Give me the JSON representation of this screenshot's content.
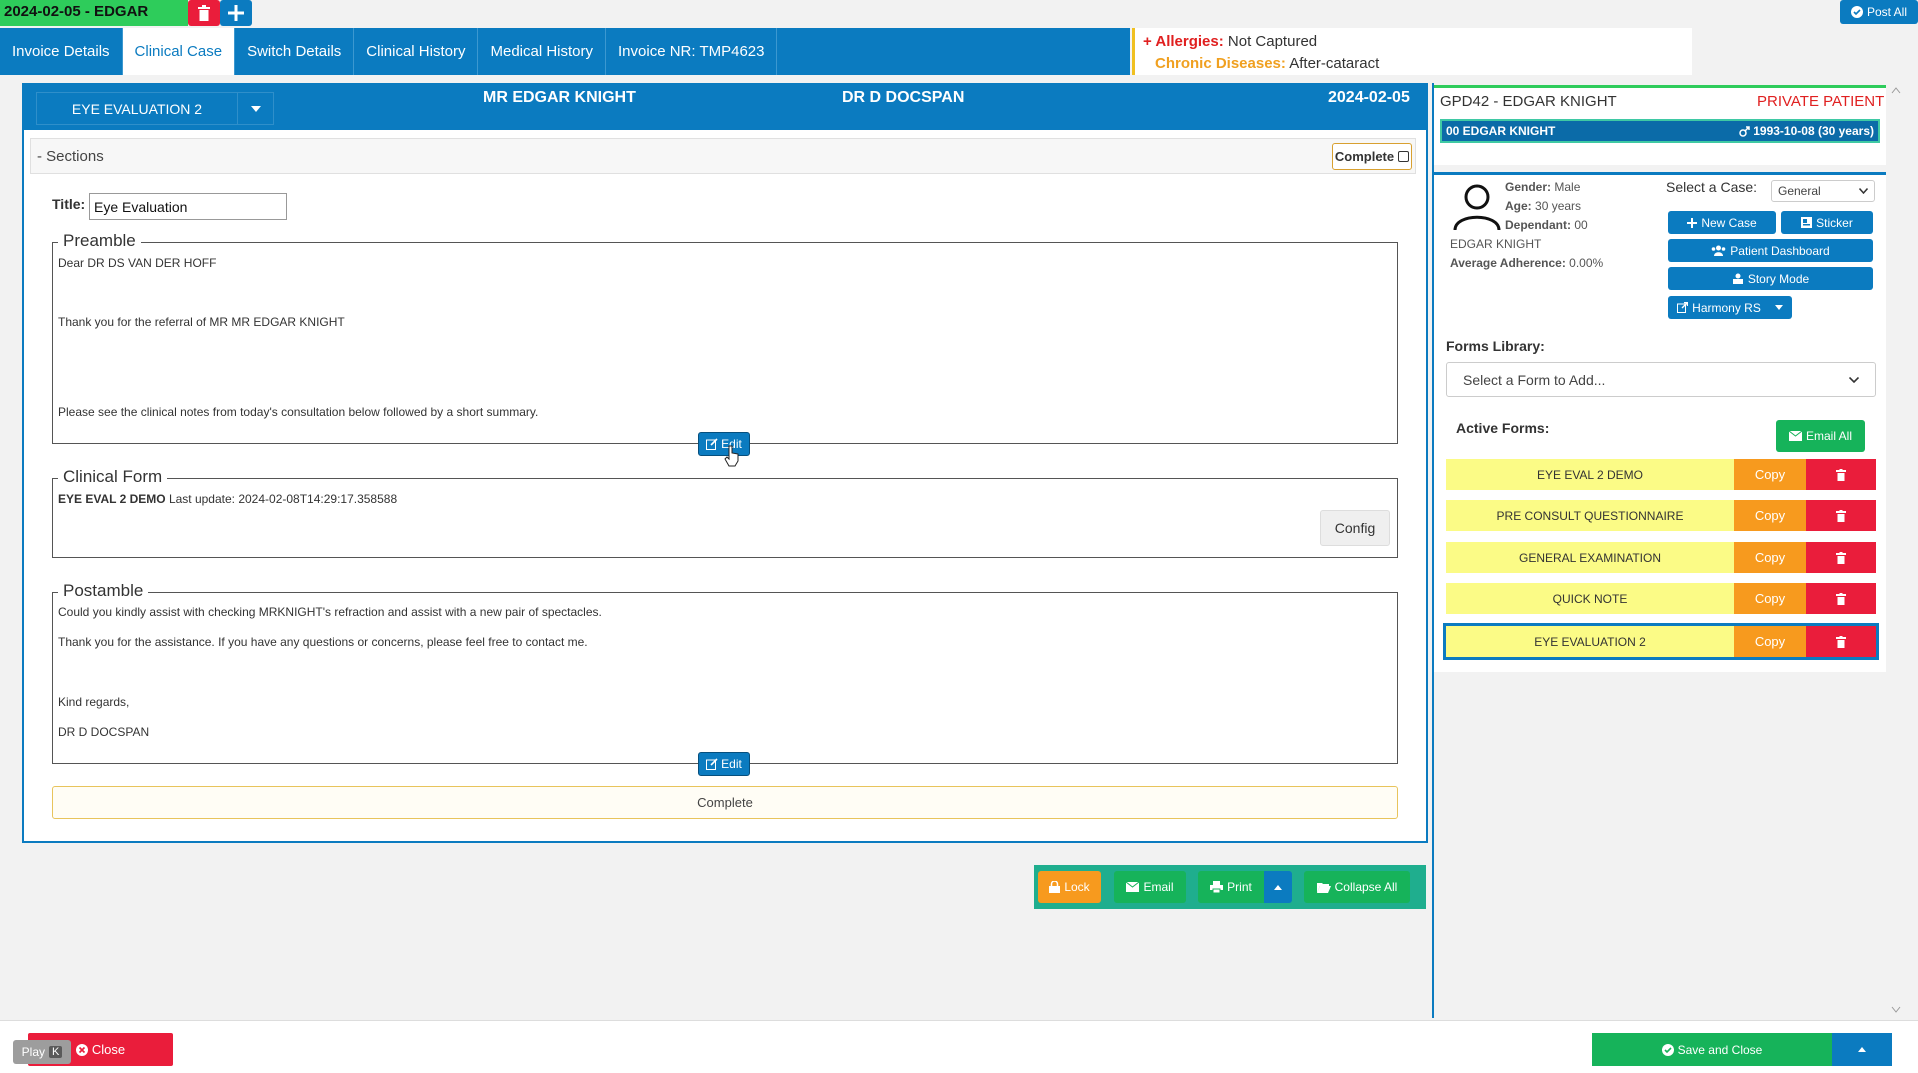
{
  "top": {
    "case_tab": "2024-02-05 - EDGAR",
    "post_all": "Post All"
  },
  "nav": {
    "tabs": [
      "Invoice Details",
      "Clinical Case",
      "Switch Details",
      "Clinical History",
      "Medical History",
      "Invoice NR: TMP4623"
    ],
    "active": "Clinical Case"
  },
  "alerts": {
    "allergies_label": "Allergies:",
    "allergies_value": "Not Captured",
    "chronic_label": "Chronic Diseases:",
    "chronic_value": "After-cataract"
  },
  "header": {
    "form_select": "EYE EVALUATION 2",
    "patient": "MR EDGAR KNIGHT",
    "doctor": "DR D DOCSPAN",
    "date": "2024-02-05"
  },
  "sections": {
    "label": "- Sections",
    "complete_label": "Complete",
    "title_label": "Title:",
    "title_value": "Eye Evaluation"
  },
  "preamble": {
    "legend": "Preamble",
    "line1": "Dear DR DS VAN DER HOFF",
    "line2": "Thank you for the referral of  MR  MR EDGAR KNIGHT",
    "line3": "Please see the clinical notes from today's consultation below followed by a short summary.",
    "edit": "Edit"
  },
  "clinical_form": {
    "legend": "Clinical Form",
    "name": "EYE EVAL 2 DEMO",
    "update": "Last update: 2024-02-08T14:29:17.358588",
    "config": "Config"
  },
  "postamble": {
    "legend": "Postamble",
    "line1": "Could you kindly assist with checking MRKNIGHT's refraction and assist with a new pair of spectacles.",
    "line2": "Thank you for the assistance. If you have any questions or concerns, please feel free to contact me.",
    "line3": "Kind regards,",
    "line4": "DR D DOCSPAN",
    "edit": "Edit"
  },
  "complete_bar": "Complete",
  "actions": {
    "lock": "Lock",
    "email": "Email",
    "print": "Print",
    "collapse": "Collapse All"
  },
  "patient": {
    "id_name": "GPD42 - EDGAR KNIGHT",
    "type": "PRIVATE PATIENT",
    "strip_name": "00 EDGAR KNIGHT",
    "strip_dob": "1993-10-08 (30 years)",
    "gender_label": "Gender:",
    "gender": "Male",
    "age_label": "Age:",
    "age": "30 years",
    "dependant_label": "Dependant:",
    "dependant": "00",
    "name": "EDGAR KNIGHT",
    "adherence_label": "Average Adherence:",
    "adherence": "0.00%"
  },
  "case": {
    "select_label": "Select a Case:",
    "select_value": "General",
    "new_case": "New Case",
    "sticker": "Sticker",
    "dashboard": "Patient Dashboard",
    "story": "Story Mode",
    "harmony": "Harmony RS"
  },
  "library": {
    "label": "Forms Library:",
    "placeholder": "Select a Form to Add...",
    "active_label": "Active Forms:",
    "email_all": "Email All",
    "forms": [
      {
        "name": "EYE EVAL 2 DEMO",
        "copy": "Copy"
      },
      {
        "name": "PRE CONSULT QUESTIONNAIRE",
        "copy": "Copy"
      },
      {
        "name": "GENERAL EXAMINATION",
        "copy": "Copy"
      },
      {
        "name": "QUICK NOTE",
        "copy": "Copy"
      },
      {
        "name": "EYE EVALUATION 2",
        "copy": "Copy"
      }
    ]
  },
  "bottom": {
    "close": "Close",
    "play": "Play",
    "play_key": "K",
    "save_close": "Save and Close"
  }
}
